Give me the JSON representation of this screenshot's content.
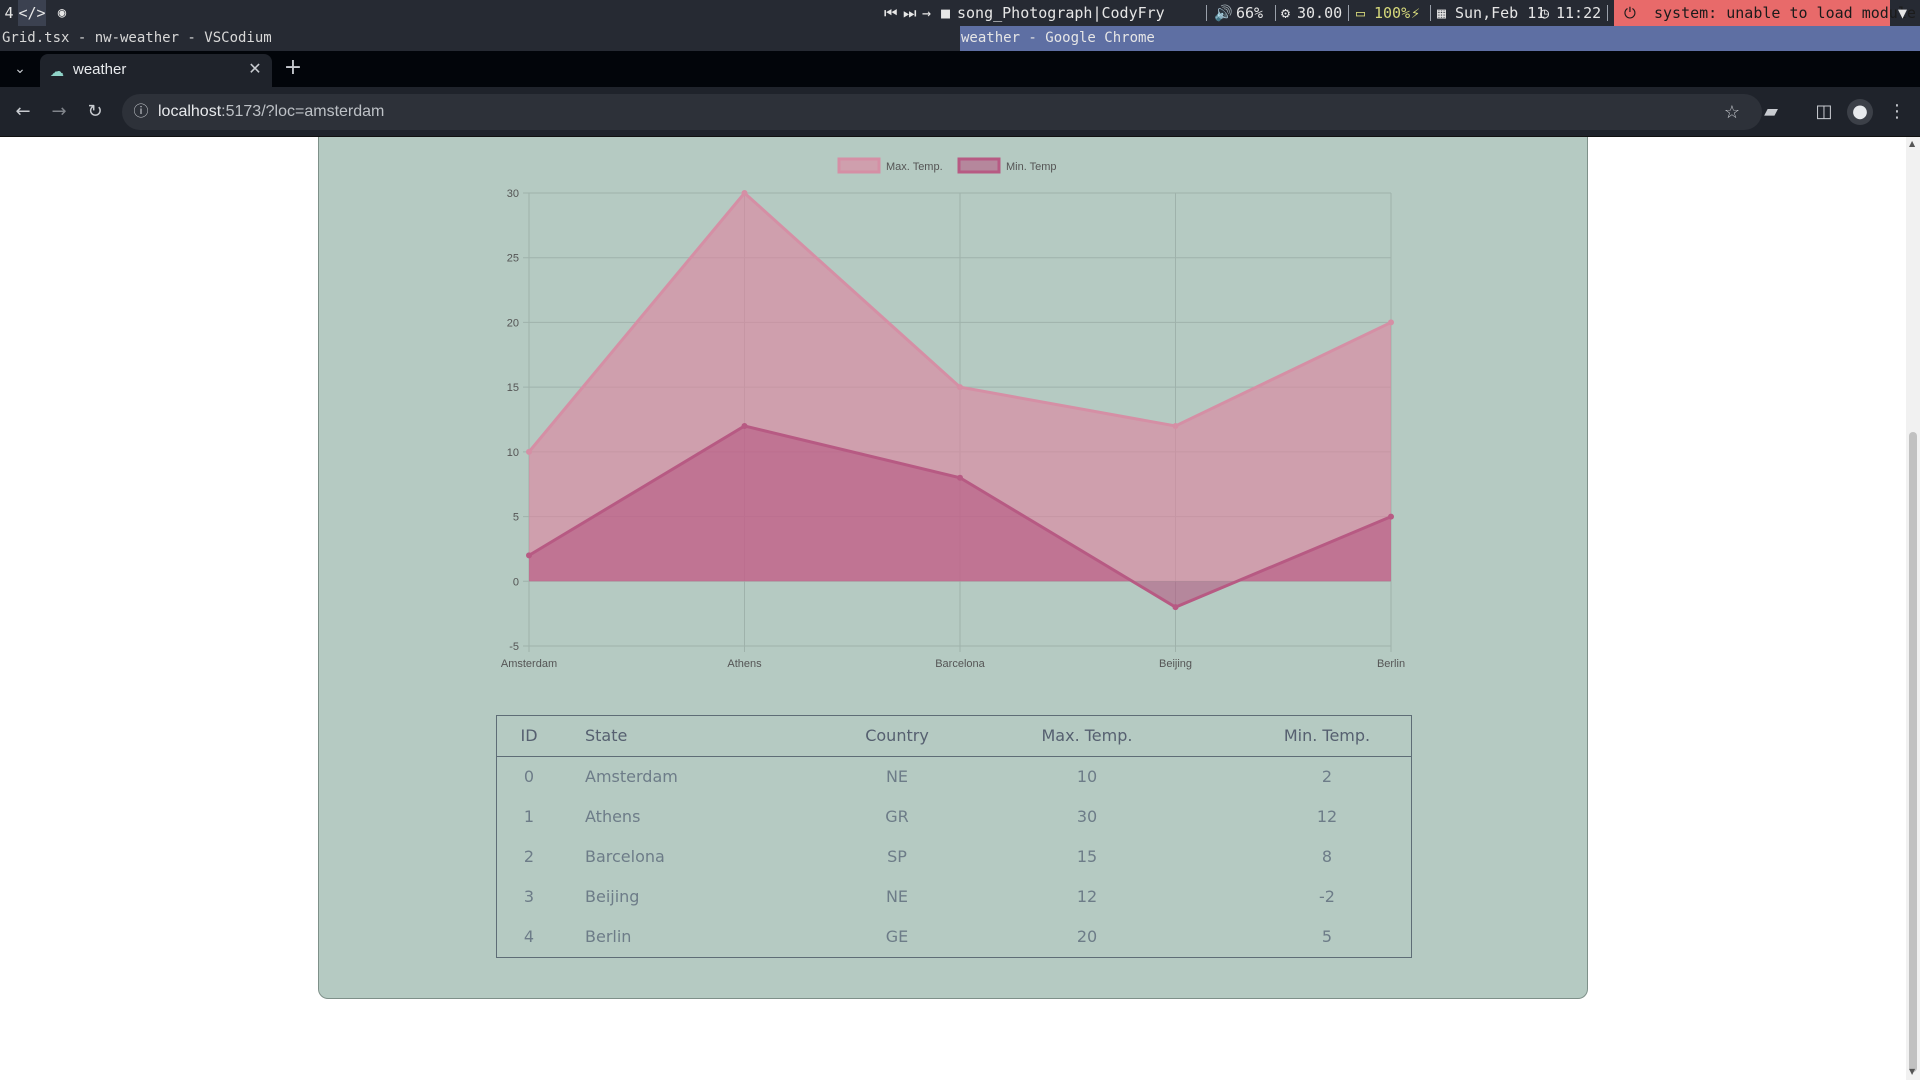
{
  "system_bar": {
    "workspace": "4",
    "media": {
      "track": "song_Photograph|CodyFry"
    },
    "volume": "66%",
    "cpu": "30.00",
    "battery": "100%",
    "date": "Sun,Feb 11",
    "time": "11:22",
    "alert": "system: unable to load module"
  },
  "window_titles": {
    "editor": "Grid.tsx - nw-weather - VSCodium",
    "browser": "weather - Google Chrome"
  },
  "browser": {
    "tab_title": "weather",
    "url_host": "localhost",
    "url_rest": ":5173/?loc=amsterdam"
  },
  "chart_data": {
    "type": "area",
    "categories": [
      "Amsterdam",
      "Athens",
      "Barcelona",
      "Beijing",
      "Berlin"
    ],
    "series": [
      {
        "name": "Max. Temp.",
        "values": [
          10,
          30,
          15,
          12,
          20
        ],
        "color": "#d58fa5"
      },
      {
        "name": "Min. Temp",
        "values": [
          2,
          12,
          8,
          -2,
          5
        ],
        "color": "#b75a83"
      }
    ],
    "ylim": [
      -5,
      30
    ],
    "yticks": [
      30,
      25,
      20,
      15,
      10,
      5,
      0,
      -5
    ],
    "grid": true,
    "legend": "top-center"
  },
  "table": {
    "headers": [
      "ID",
      "State",
      "Country",
      "Max. Temp.",
      "Min. Temp."
    ],
    "rows": [
      [
        "0",
        "Amsterdam",
        "NE",
        "10",
        "2"
      ],
      [
        "1",
        "Athens",
        "GR",
        "30",
        "12"
      ],
      [
        "2",
        "Barcelona",
        "SP",
        "15",
        "8"
      ],
      [
        "3",
        "Beijing",
        "NE",
        "12",
        "-2"
      ],
      [
        "4",
        "Berlin",
        "GE",
        "20",
        "5"
      ]
    ]
  },
  "colors": {
    "card_bg": "#b5cac2",
    "max_series": "#d58fa5",
    "min_series": "#b75a83",
    "alert_bg": "#e86a6a"
  }
}
